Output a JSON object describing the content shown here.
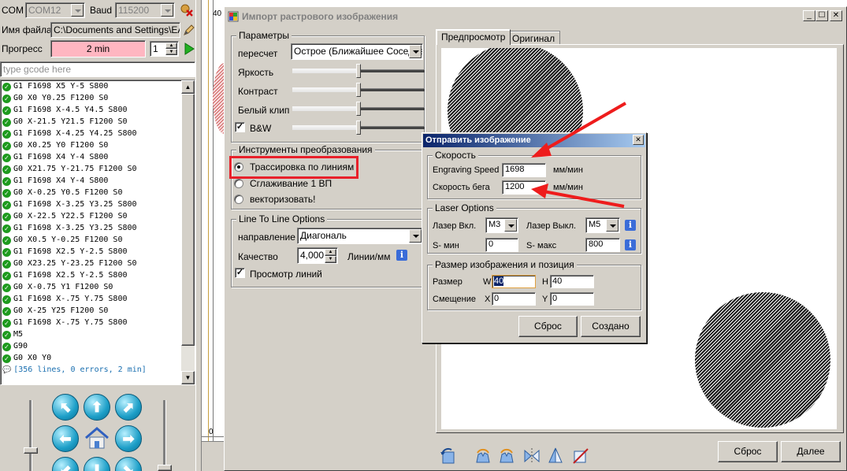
{
  "main": {
    "com_label": "COM",
    "com_value": "COM12",
    "baud_label": "Baud",
    "baud_value": "115200",
    "filename_label": "Имя файла",
    "filename_value": "C:\\Documents and Settings\\EA\\",
    "progress_label": "Прогресс",
    "progress_value": "2 min",
    "repeat_value": "1",
    "gcode_placeholder": "type gcode here",
    "gcode_lines": [
      "G1 F1698 X5 Y-5 S800",
      "G0 X0 Y0.25 F1200 S0",
      "G1 F1698 X-4.5 Y4.5 S800",
      "G0 X-21.5 Y21.5 F1200 S0",
      "G1 F1698 X-4.25 Y4.25 S800",
      "G0 X0.25 Y0 F1200 S0",
      "G1 F1698 X4 Y-4 S800",
      "G0 X21.75 Y-21.75 F1200 S0",
      "G1 F1698 X4 Y-4 S800",
      "G0 X-0.25 Y0.5 F1200 S0",
      "G1 F1698 X-3.25 Y3.25 S800",
      "G0 X-22.5 Y22.5 F1200 S0",
      "G1 F1698 X-3.25 Y3.25 S800",
      "G0 X0.5 Y-0.25 F1200 S0",
      "G1 F1698 X2.5 Y-2.5 S800",
      "G0 X23.25 Y-23.25 F1200 S0",
      "G1 F1698 X2.5 Y-2.5 S800",
      "G0 X-0.75 Y1 F1200 S0",
      "G1 F1698 X-.75 Y.75 S800",
      "G0 X-25 Y25 F1200 S0",
      "G1 F1698 X-.75 Y.75 S800",
      "M5",
      "G90",
      "G0 X0 Y0"
    ],
    "gcode_summary": "[356 lines, 0 errors, 2 min]",
    "canvas_tick_left": "40",
    "canvas_tick_bottom": "0"
  },
  "import_window": {
    "title": "Импорт растрового изображения",
    "params_group": "Параметры",
    "resample_label": "пересчет",
    "resample_value": "Острое (Ближайшее Соседнее)",
    "brightness_label": "Яркость",
    "contrast_label": "Контраст",
    "whiteclip_label": "Белый клип",
    "bw_label": "B&W",
    "tools_group": "Инструменты преобразования",
    "tool_options": [
      "Трассировка по линиям",
      "Сглаживание 1 ВП",
      "векторизовать!"
    ],
    "ltl_group": "Line To Line Options",
    "direction_label": "направление",
    "direction_value": "Диагональ",
    "quality_label": "Качество",
    "quality_value": "4,000",
    "quality_unit": "Линии/мм",
    "preview_lines_label": "Просмотр линий",
    "tab_preview": "Предпросмотр",
    "tab_original": "Оригинал",
    "reset_button": "Сброс",
    "next_button": "Далее"
  },
  "send_dialog": {
    "title": "Отправить изображение",
    "speed_group": "Скорость",
    "engraving_speed_label": "Engraving Speed",
    "engraving_speed_value": "1698",
    "engraving_speed_unit": "мм/мин",
    "travel_speed_label": "Скорость бега",
    "travel_speed_value": "1200",
    "travel_speed_unit": "мм/мин",
    "laser_group": "Laser Options",
    "laser_on_label": "Лазер Вкл.",
    "laser_on_value": "M3",
    "laser_off_label": "Лазер Выкл.",
    "laser_off_value": "M5",
    "smin_label": "S- мин",
    "smin_value": "0",
    "smax_label": "S- макс",
    "smax_value": "800",
    "size_group": "Размер изображения и позиция",
    "size_label": "Размер",
    "w_label": "W",
    "w_value": "40",
    "h_label": "H",
    "h_value": "40",
    "offset_label": "Смещение",
    "x_label": "X",
    "x_value": "0",
    "y_label": "Y",
    "y_value": "0",
    "reset_button": "Сброс",
    "create_button": "Создано"
  },
  "colors": {
    "title_bar": "#0a246a",
    "highlight_box": "#e8202a",
    "annotation_arrow": "#ee1c1c",
    "progress_fill": "#ffb6c1",
    "success_icon": "#1e9a1e"
  }
}
